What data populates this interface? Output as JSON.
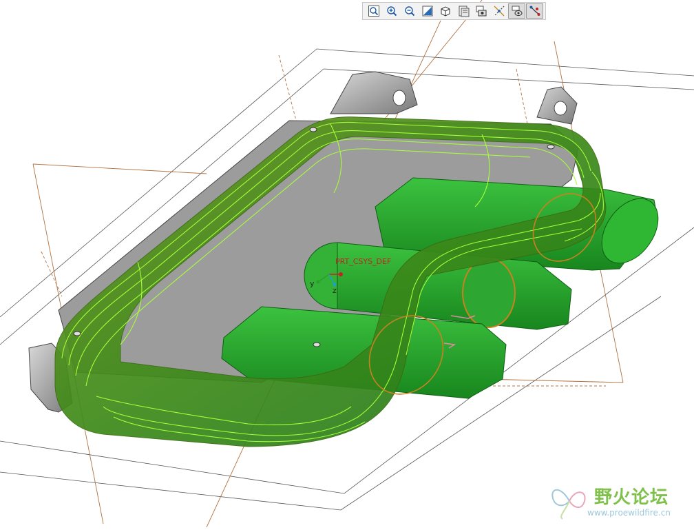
{
  "toolbar": {
    "buttons": [
      {
        "id": "refit",
        "icon": "zoom-fit-icon",
        "active": false
      },
      {
        "id": "zoom_in",
        "icon": "zoom-in-icon",
        "active": false
      },
      {
        "id": "zoom_out",
        "icon": "zoom-out-icon",
        "active": false
      },
      {
        "id": "repaint",
        "icon": "repaint-icon",
        "active": false
      },
      {
        "id": "saved_views",
        "icon": "orient-cube-icon",
        "active": false
      },
      {
        "id": "display_style",
        "icon": "display-style-icon",
        "active": false
      },
      {
        "id": "view_manager",
        "icon": "view-manager-icon",
        "active": false
      },
      {
        "id": "datum_display",
        "icon": "datum-display-icon",
        "active": false
      },
      {
        "id": "spin_center",
        "icon": "spin-center-icon",
        "active": true
      },
      {
        "id": "annotation",
        "icon": "annotation-display-icon",
        "active": true
      }
    ]
  },
  "model": {
    "csys_label": "PRT_CSYS_DEF",
    "axes": {
      "y": "y",
      "z": "z"
    }
  },
  "colors": {
    "datum_plane": "#b0713f",
    "outline": "#555555",
    "highlight": "#a6ff3a",
    "part_green": "#26a02a",
    "part_gray": "#9a9a9a",
    "csys_red": "#c52222"
  },
  "watermark": {
    "chinese": "野火论坛",
    "url": "www.proewildfire.cn"
  }
}
